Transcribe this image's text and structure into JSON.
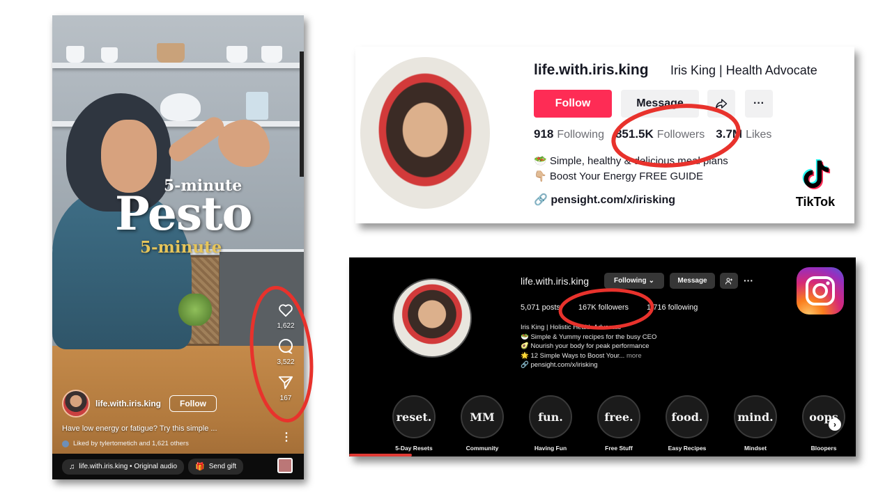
{
  "reel": {
    "title_small": "5-minute",
    "title_big": "Pesto",
    "title_gold": "5-minute",
    "likes": "1,622",
    "comments": "3,522",
    "shares": "167",
    "username": "life.with.iris.king",
    "follow_label": "Follow",
    "caption": "Have low energy or fatigue? Try this simple ...",
    "liked_by": "Liked by tylertometich and 1,621 others",
    "audio": "life.with.iris.king • Original audio",
    "send_gift": "Send gift"
  },
  "tiktok": {
    "username": "life.with.iris.king",
    "nickname": "Iris King | Health Advocate",
    "follow_label": "Follow",
    "message_label": "Message",
    "following_count": "918",
    "following_label": "Following",
    "followers_count": "851.5K",
    "followers_label": "Followers",
    "likes_count": "3.7M",
    "likes_label": "Likes",
    "bio_line1": "🥗 Simple, healthy & delicious meal plans",
    "bio_line2": "👇🏼 Boost Your Energy FREE GUIDE",
    "link": "pensight.com/x/irisking",
    "logo_text": "TikTok"
  },
  "instagram": {
    "username": "life.with.iris.king",
    "following_button": "Following",
    "message_button": "Message",
    "posts": "5,071 posts",
    "followers": "167K followers",
    "following": "1,716 following",
    "bio_name": "Iris King | Holistic Health Advocate",
    "bio_line1": "🥗 Simple & Yummy recipes for the busy CEO",
    "bio_line2": "🥑 Nourish your body for peak performance",
    "bio_line3": "🌟 12 Simple Ways to Boost Your...",
    "bio_more": "more",
    "link": "pensight.com/x/irisking",
    "highlights": [
      {
        "cover": "reset.",
        "label": "5-Day Resets"
      },
      {
        "cover": "MM",
        "label": "Community"
      },
      {
        "cover": "fun.",
        "label": "Having Fun"
      },
      {
        "cover": "free.",
        "label": "Free Stuff"
      },
      {
        "cover": "food.",
        "label": "Easy Recipes"
      },
      {
        "cover": "mind.",
        "label": "Mindset"
      },
      {
        "cover": "oops",
        "label": "Bloopers"
      }
    ]
  },
  "colors": {
    "tiktok_follow": "#fe2c55",
    "annotation_red": "#e8322c",
    "instagram_bg": "#000000"
  },
  "icons": [
    "heart-icon",
    "comment-icon",
    "send-icon",
    "music-icon",
    "gift-icon",
    "share-icon",
    "more-icon",
    "link-icon",
    "tiktok-logo",
    "instagram-logo",
    "add-user-icon",
    "chevron-right-icon"
  ]
}
